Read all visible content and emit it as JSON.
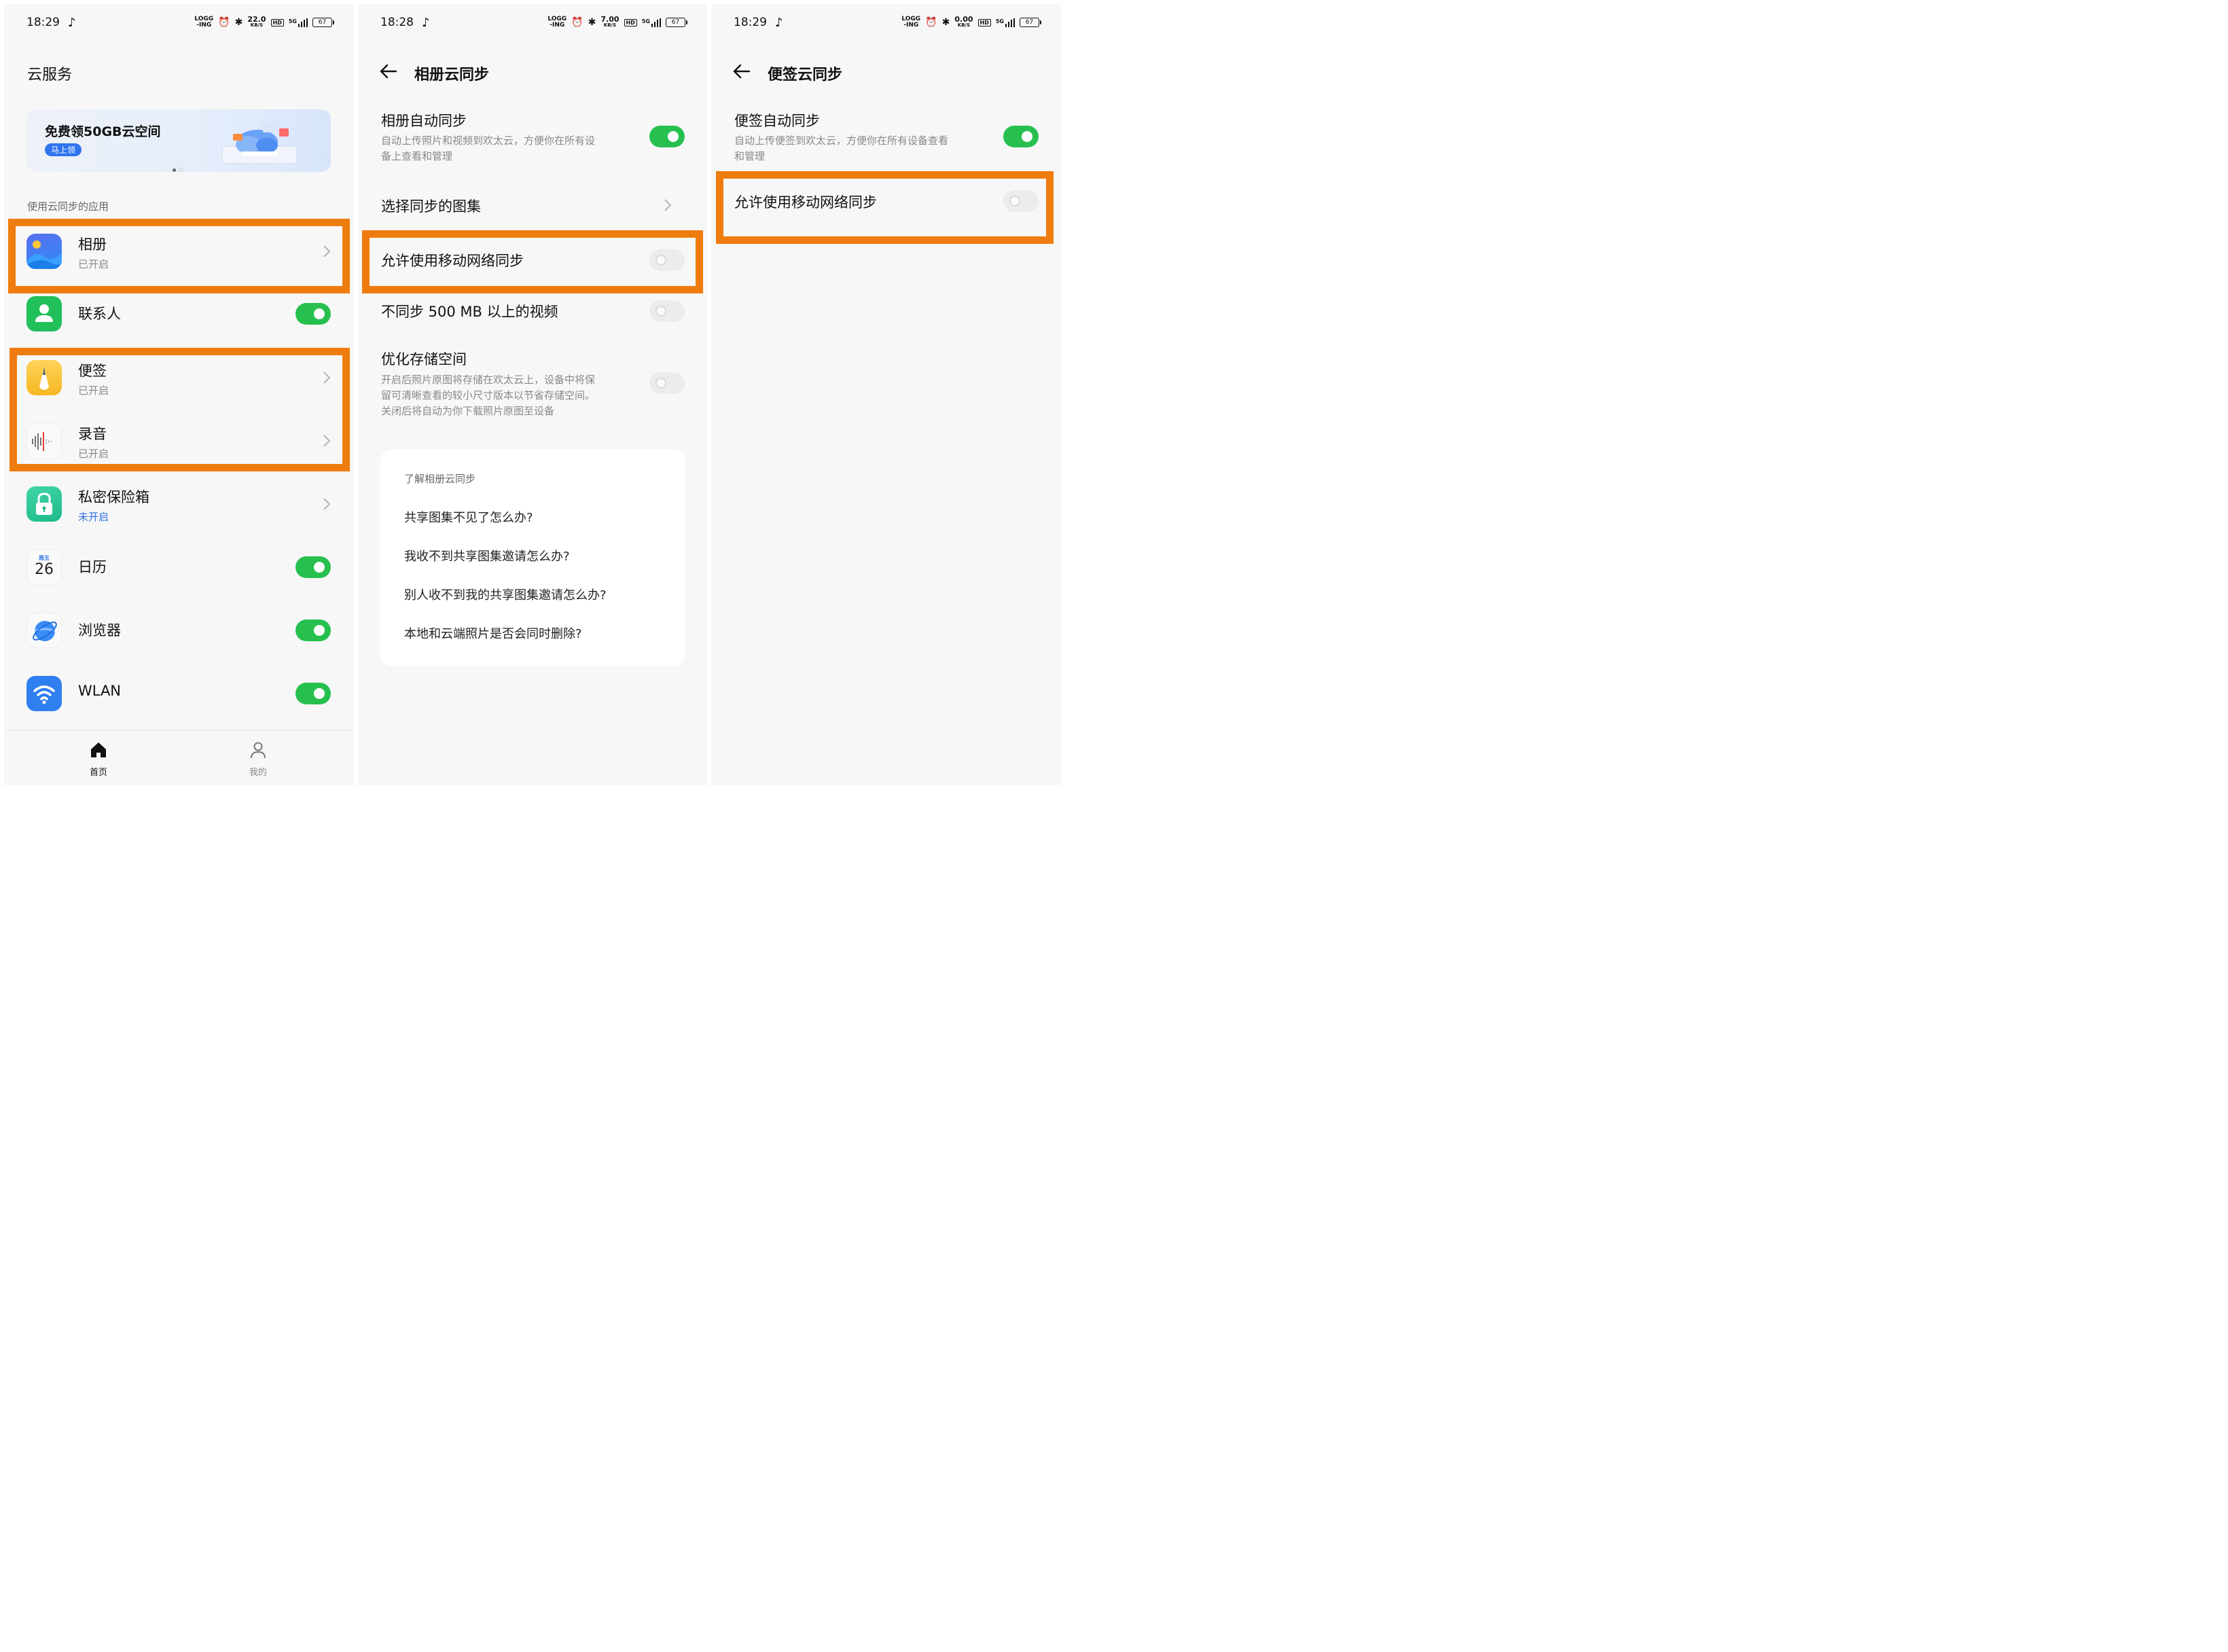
{
  "status_bars": [
    {
      "time": "18:29",
      "speed": "22.0",
      "speed_unit": "KB/S",
      "battery": "67",
      "net_top": "LOGG",
      "net_bottom": "-ING",
      "signal": "5G"
    },
    {
      "time": "18:28",
      "speed": "7.00",
      "speed_unit": "KB/S",
      "battery": "67",
      "net_top": "LOGG",
      "net_bottom": "-ING",
      "signal": "5G"
    },
    {
      "time": "18:29",
      "speed": "0.00",
      "speed_unit": "KB/S",
      "battery": "67",
      "net_top": "LOGG",
      "net_bottom": "-ING",
      "signal": "5G"
    }
  ],
  "screen1": {
    "title": "云服务",
    "banner": {
      "title": "免费领50GB云空间",
      "button": "马上领"
    },
    "section_label": "使用云同步的应用",
    "apps": [
      {
        "name": "相册",
        "status": "已开启",
        "control": "chevron",
        "icon": "gallery-icon"
      },
      {
        "name": "联系人",
        "status": "",
        "control": "toggle-on",
        "icon": "contacts-icon"
      },
      {
        "name": "便签",
        "status": "已开启",
        "control": "chevron",
        "icon": "notes-icon"
      },
      {
        "name": "录音",
        "status": "已开启",
        "control": "chevron",
        "icon": "recorder-icon"
      },
      {
        "name": "私密保险箱",
        "status": "未开启",
        "control": "chevron",
        "icon": "safe-icon"
      },
      {
        "name": "日历",
        "status": "",
        "control": "toggle-on",
        "icon": "calendar-icon",
        "calendar_weekday": "周五",
        "calendar_day": "26"
      },
      {
        "name": "浏览器",
        "status": "",
        "control": "toggle-on",
        "icon": "browser-icon"
      },
      {
        "name": "WLAN",
        "status": "",
        "control": "toggle-on",
        "icon": "wlan-icon"
      }
    ],
    "nav": [
      {
        "label": "首页",
        "icon": "home-icon",
        "active": true
      },
      {
        "label": "我的",
        "icon": "profile-icon",
        "active": false
      }
    ]
  },
  "screen2": {
    "title": "相册云同步",
    "auto_sync": {
      "title": "相册自动同步",
      "desc_line1": "自动上传照片和视频到欢太云，方便你在所有设",
      "desc_line2": "备上查看和管理",
      "state": "on"
    },
    "choose_albums": "选择同步的图集",
    "mobile_sync": {
      "title": "允许使用移动网络同步",
      "state": "off"
    },
    "skip_large": {
      "title": "不同步 500 MB 以上的视频",
      "state": "off"
    },
    "optimize": {
      "title": "优化存储空间",
      "desc_line1": "开启后照片原图将存储在欢太云上，设备中将保",
      "desc_line2": "留可清晰查看的较小尺寸版本以节省存储空间。",
      "desc_line3": "关闭后将自动为你下载照片原图至设备",
      "state": "off"
    },
    "help": {
      "title": "了解相册云同步",
      "items": [
        "共享图集不见了怎么办?",
        "我收不到共享图集邀请怎么办?",
        "别人收不到我的共享图集邀请怎么办?",
        "本地和云端照片是否会同时删除?"
      ]
    }
  },
  "screen3": {
    "title": "便签云同步",
    "auto_sync": {
      "title": "便签自动同步",
      "desc_line1": "自动上传便签到欢太云，方便你在所有设备查看",
      "desc_line2": "和管理",
      "state": "on"
    },
    "mobile_sync": {
      "title": "允许使用移动网络同步",
      "state": "off"
    }
  },
  "colors": {
    "highlight": "#ef7c0e",
    "toggle_on": "#27c04f",
    "link_blue": "#2f6fe4",
    "background": "#f7f7f7"
  }
}
